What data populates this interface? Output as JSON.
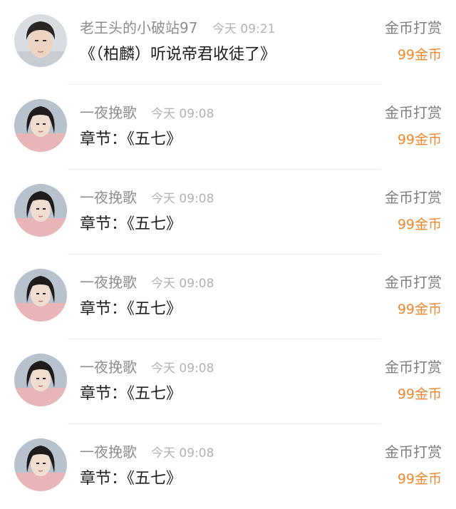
{
  "rewards": [
    {
      "sender": "老王头的小破站97",
      "time": "今天 09:21",
      "message": "《（柏麟）听说帝君收徒了》",
      "reward_type": "金币打赏",
      "reward_amount": "99金币",
      "avatar": "male-avatar"
    },
    {
      "sender": "一夜挽歌",
      "time": "今天 09:08",
      "message": "章节：《五七》",
      "reward_type": "金币打赏",
      "reward_amount": "99金币",
      "avatar": "female-avatar"
    },
    {
      "sender": "一夜挽歌",
      "time": "今天 09:08",
      "message": "章节：《五七》",
      "reward_type": "金币打赏",
      "reward_amount": "99金币",
      "avatar": "female-avatar"
    },
    {
      "sender": "一夜挽歌",
      "time": "今天 09:08",
      "message": "章节：《五七》",
      "reward_type": "金币打赏",
      "reward_amount": "99金币",
      "avatar": "female-avatar"
    },
    {
      "sender": "一夜挽歌",
      "time": "今天 09:08",
      "message": "章节：《五七》",
      "reward_type": "金币打赏",
      "reward_amount": "99金币",
      "avatar": "female-avatar"
    },
    {
      "sender": "一夜挽歌",
      "time": "今天 09:08",
      "message": "章节：《五七》",
      "reward_type": "金币打赏",
      "reward_amount": "99金币",
      "avatar": "female-avatar"
    }
  ]
}
